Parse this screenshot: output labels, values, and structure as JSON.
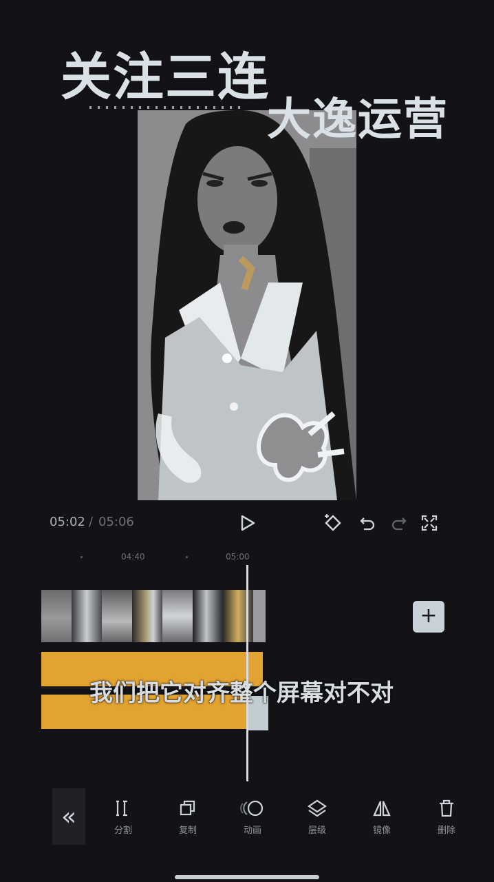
{
  "overlay": {
    "title": "关注三连",
    "subtitle": "大逸运营"
  },
  "player": {
    "current_time": "05:02",
    "separator": "/",
    "total_time": "05:06"
  },
  "ruler": {
    "ticks": [
      "04:40",
      "05:00"
    ]
  },
  "timeline": {
    "add_label": "+",
    "subtitle_text": "我们把它对齐整个屏幕对不对"
  },
  "toolbar": {
    "collapse_label": "«",
    "tools": [
      {
        "label": "分割",
        "icon": "split-icon"
      },
      {
        "label": "复制",
        "icon": "copy-icon"
      },
      {
        "label": "动画",
        "icon": "animation-icon"
      },
      {
        "label": "层级",
        "icon": "layers-icon"
      },
      {
        "label": "镜像",
        "icon": "mirror-icon"
      },
      {
        "label": "删除",
        "icon": "delete-icon"
      }
    ]
  },
  "colors": {
    "background": "#131217",
    "audio_track": "#e2a332",
    "accent_light": "#c9d2d8"
  }
}
